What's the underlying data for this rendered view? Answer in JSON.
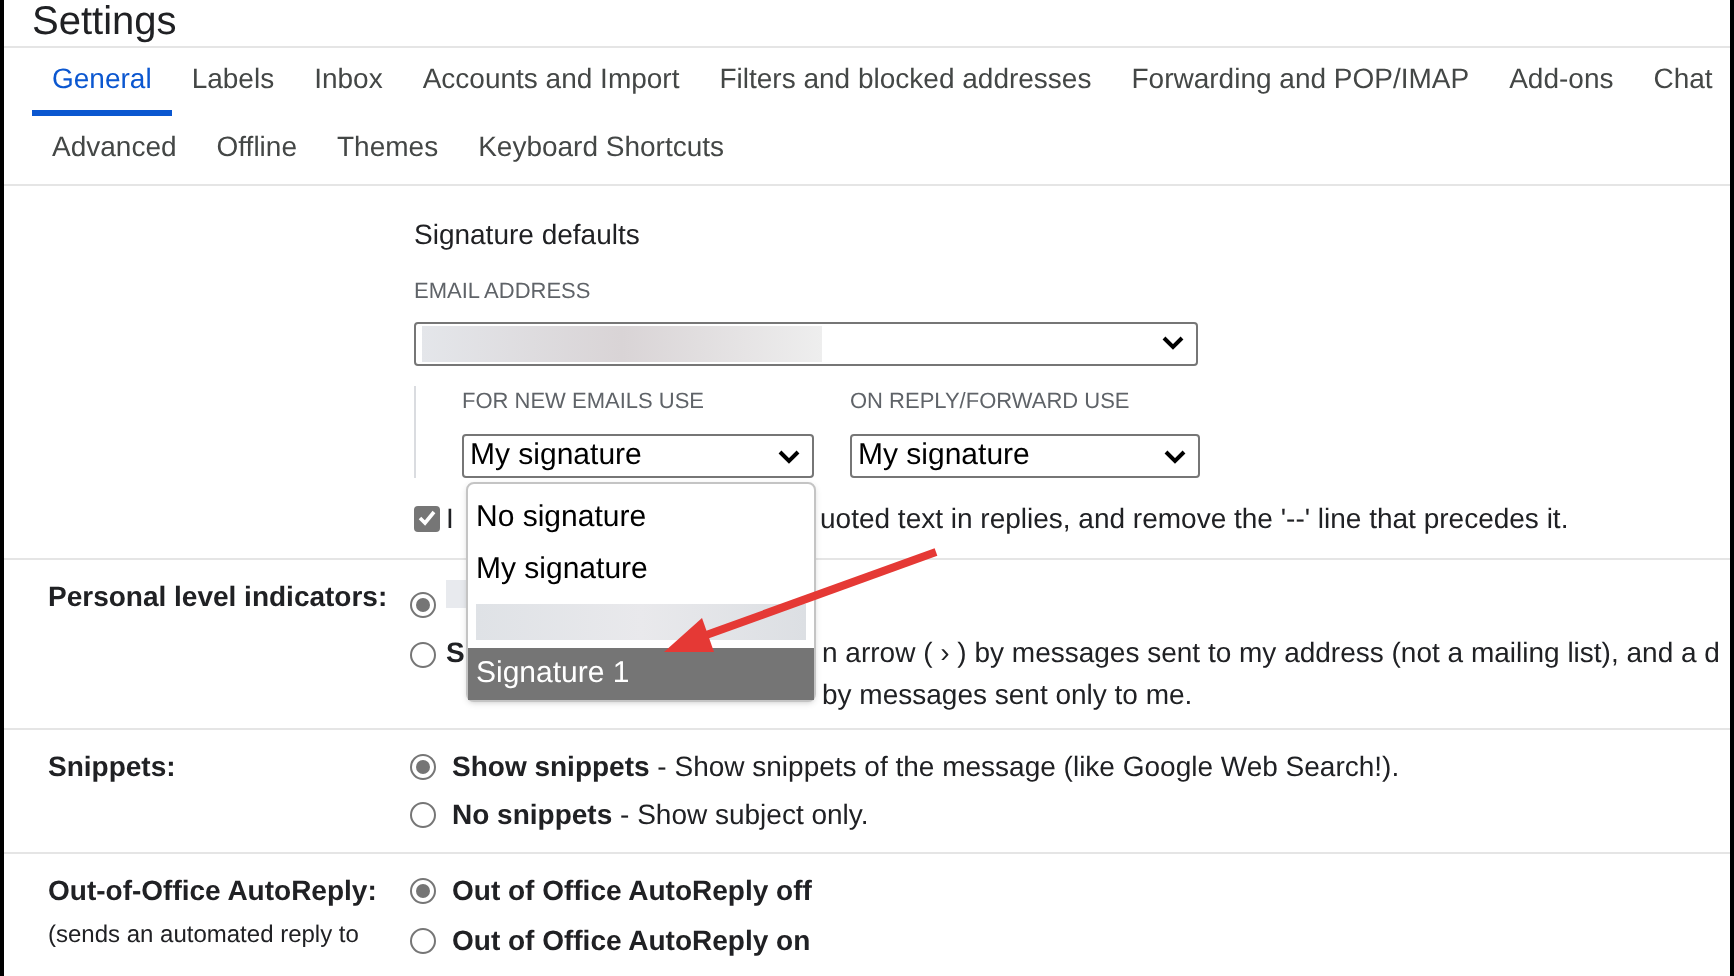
{
  "page_title": "Settings",
  "tabs_row_1": [
    {
      "label": "General",
      "selected": true
    },
    {
      "label": "Labels",
      "selected": false
    },
    {
      "label": "Inbox",
      "selected": false
    },
    {
      "label": "Accounts and Import",
      "selected": false
    },
    {
      "label": "Filters and blocked addresses",
      "selected": false
    },
    {
      "label": "Forwarding and POP/IMAP",
      "selected": false
    },
    {
      "label": "Add-ons",
      "selected": false
    },
    {
      "label": "Chat",
      "selected": false
    }
  ],
  "tabs_row_2": [
    {
      "label": "Advanced",
      "selected": false
    },
    {
      "label": "Offline",
      "selected": false
    },
    {
      "label": "Themes",
      "selected": false
    },
    {
      "label": "Keyboard Shortcuts",
      "selected": false
    }
  ],
  "signature_defaults": {
    "heading": "Signature defaults",
    "email_label": "EMAIL ADDRESS",
    "new_label": "FOR NEW EMAILS USE",
    "new_value": "My signature",
    "reply_label": "ON REPLY/FORWARD USE",
    "reply_value": "My signature",
    "checkbox": {
      "checked": true,
      "text_before": "I",
      "text_after": "uoted text in replies, and remove the '--' line that precedes it."
    },
    "menu": [
      {
        "kind": "text",
        "label": "No signature",
        "selected": false
      },
      {
        "kind": "text",
        "label": "My signature",
        "selected": false
      },
      {
        "kind": "blurred",
        "selected": false
      },
      {
        "kind": "text",
        "label": "Signature 1",
        "selected": true
      }
    ]
  },
  "personal_level": {
    "label": "Personal level indicators:",
    "options": [
      {
        "kind": "blurred",
        "selected": true
      },
      {
        "kind": "text",
        "selected": false,
        "lines": [
          "S",
          "n arrow ( › ) by messages sent to my address (not a mailing list), and a d",
          "by messages sent only to me."
        ]
      }
    ]
  },
  "snippets": {
    "label": "Snippets:",
    "options": [
      {
        "selected": true,
        "title": "Show snippets",
        "text": " - Show snippets of the message (like Google Web Search!)."
      },
      {
        "selected": false,
        "title": "No snippets",
        "text": " - Show subject only."
      }
    ]
  },
  "auto_reply": {
    "label": "Out-of-Office AutoReply:",
    "note": "(sends an automated reply to",
    "options": [
      {
        "selected": true,
        "title": "Out of Office AutoReply off"
      },
      {
        "selected": false,
        "title": "Out of Office AutoReply on"
      }
    ]
  }
}
